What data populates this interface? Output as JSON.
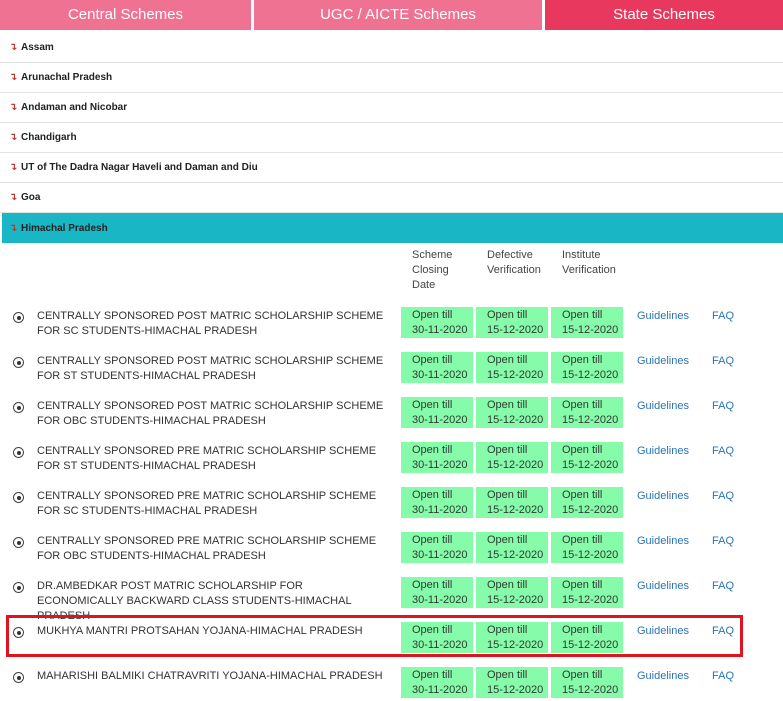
{
  "tabs": {
    "central": "Central Schemes",
    "ugc": "UGC / AICTE Schemes",
    "state": "State Schemes"
  },
  "states": [
    {
      "label": "Assam"
    },
    {
      "label": "Arunachal Pradesh"
    },
    {
      "label": "Andaman and Nicobar"
    },
    {
      "label": "Chandigarh"
    },
    {
      "label": "UT of The Dadra Nagar Haveli and Daman and Diu"
    },
    {
      "label": "Goa"
    },
    {
      "label": "Himachal Pradesh"
    }
  ],
  "columns": {
    "closing": "Scheme\nClosing\nDate",
    "defective": "Defective\nVerification",
    "institute": "Institute\nVerification"
  },
  "schemes": [
    {
      "name": "CENTRALLY SPONSORED POST MATRIC SCHOLARSHIP SCHEME FOR SC STUDENTS-HIMACHAL PRADESH",
      "closing": "Open till\n30-11-2020",
      "defective": "Open till\n15-12-2020",
      "institute": "Open till\n15-12-2020",
      "guidelines": "Guidelines",
      "faq": "FAQ"
    },
    {
      "name": "CENTRALLY SPONSORED POST MATRIC SCHOLARSHIP SCHEME FOR ST STUDENTS-HIMACHAL PRADESH",
      "closing": "Open till\n30-11-2020",
      "defective": "Open till\n15-12-2020",
      "institute": "Open till\n15-12-2020",
      "guidelines": "Guidelines",
      "faq": "FAQ"
    },
    {
      "name": "CENTRALLY SPONSORED POST MATRIC SCHOLARSHIP SCHEME FOR OBC STUDENTS-HIMACHAL PRADESH",
      "closing": "Open till\n30-11-2020",
      "defective": "Open till\n15-12-2020",
      "institute": "Open till\n15-12-2020",
      "guidelines": "Guidelines",
      "faq": "FAQ"
    },
    {
      "name": "CENTRALLY SPONSORED PRE MATRIC SCHOLARSHIP SCHEME FOR ST STUDENTS-HIMACHAL PRADESH",
      "closing": "Open till\n30-11-2020",
      "defective": "Open till\n15-12-2020",
      "institute": "Open till\n15-12-2020",
      "guidelines": "Guidelines",
      "faq": "FAQ"
    },
    {
      "name": "CENTRALLY SPONSORED PRE MATRIC SCHOLARSHIP SCHEME FOR SC STUDENTS-HIMACHAL PRADESH",
      "closing": "Open till\n30-11-2020",
      "defective": "Open till\n15-12-2020",
      "institute": "Open till\n15-12-2020",
      "guidelines": "Guidelines",
      "faq": "FAQ"
    },
    {
      "name": "CENTRALLY SPONSORED PRE MATRIC SCHOLARSHIP SCHEME FOR OBC STUDENTS-HIMACHAL PRADESH",
      "closing": "Open till\n30-11-2020",
      "defective": "Open till\n15-12-2020",
      "institute": "Open till\n15-12-2020",
      "guidelines": "Guidelines",
      "faq": "FAQ"
    },
    {
      "name": "DR.AMBEDKAR POST MATRIC SCHOLARSHIP FOR ECONOMICALLY BACKWARD CLASS STUDENTS-HIMACHAL PRADESH",
      "closing": "Open till\n30-11-2020",
      "defective": "Open till\n15-12-2020",
      "institute": "Open till\n15-12-2020",
      "guidelines": "Guidelines",
      "faq": "FAQ"
    },
    {
      "name": "MUKHYA MANTRI PROTSAHAN YOJANA-HIMACHAL PRADESH",
      "closing": "Open till\n30-11-2020",
      "defective": "Open till\n15-12-2020",
      "institute": "Open till\n15-12-2020",
      "guidelines": "Guidelines",
      "faq": "FAQ"
    },
    {
      "name": "MAHARISHI BALMIKI CHATRAVRITI YOJANA-HIMACHAL PRADESH",
      "closing": "Open till\n30-11-2020",
      "defective": "Open till\n15-12-2020",
      "institute": "Open till\n15-12-2020",
      "guidelines": "Guidelines",
      "faq": "FAQ"
    }
  ]
}
